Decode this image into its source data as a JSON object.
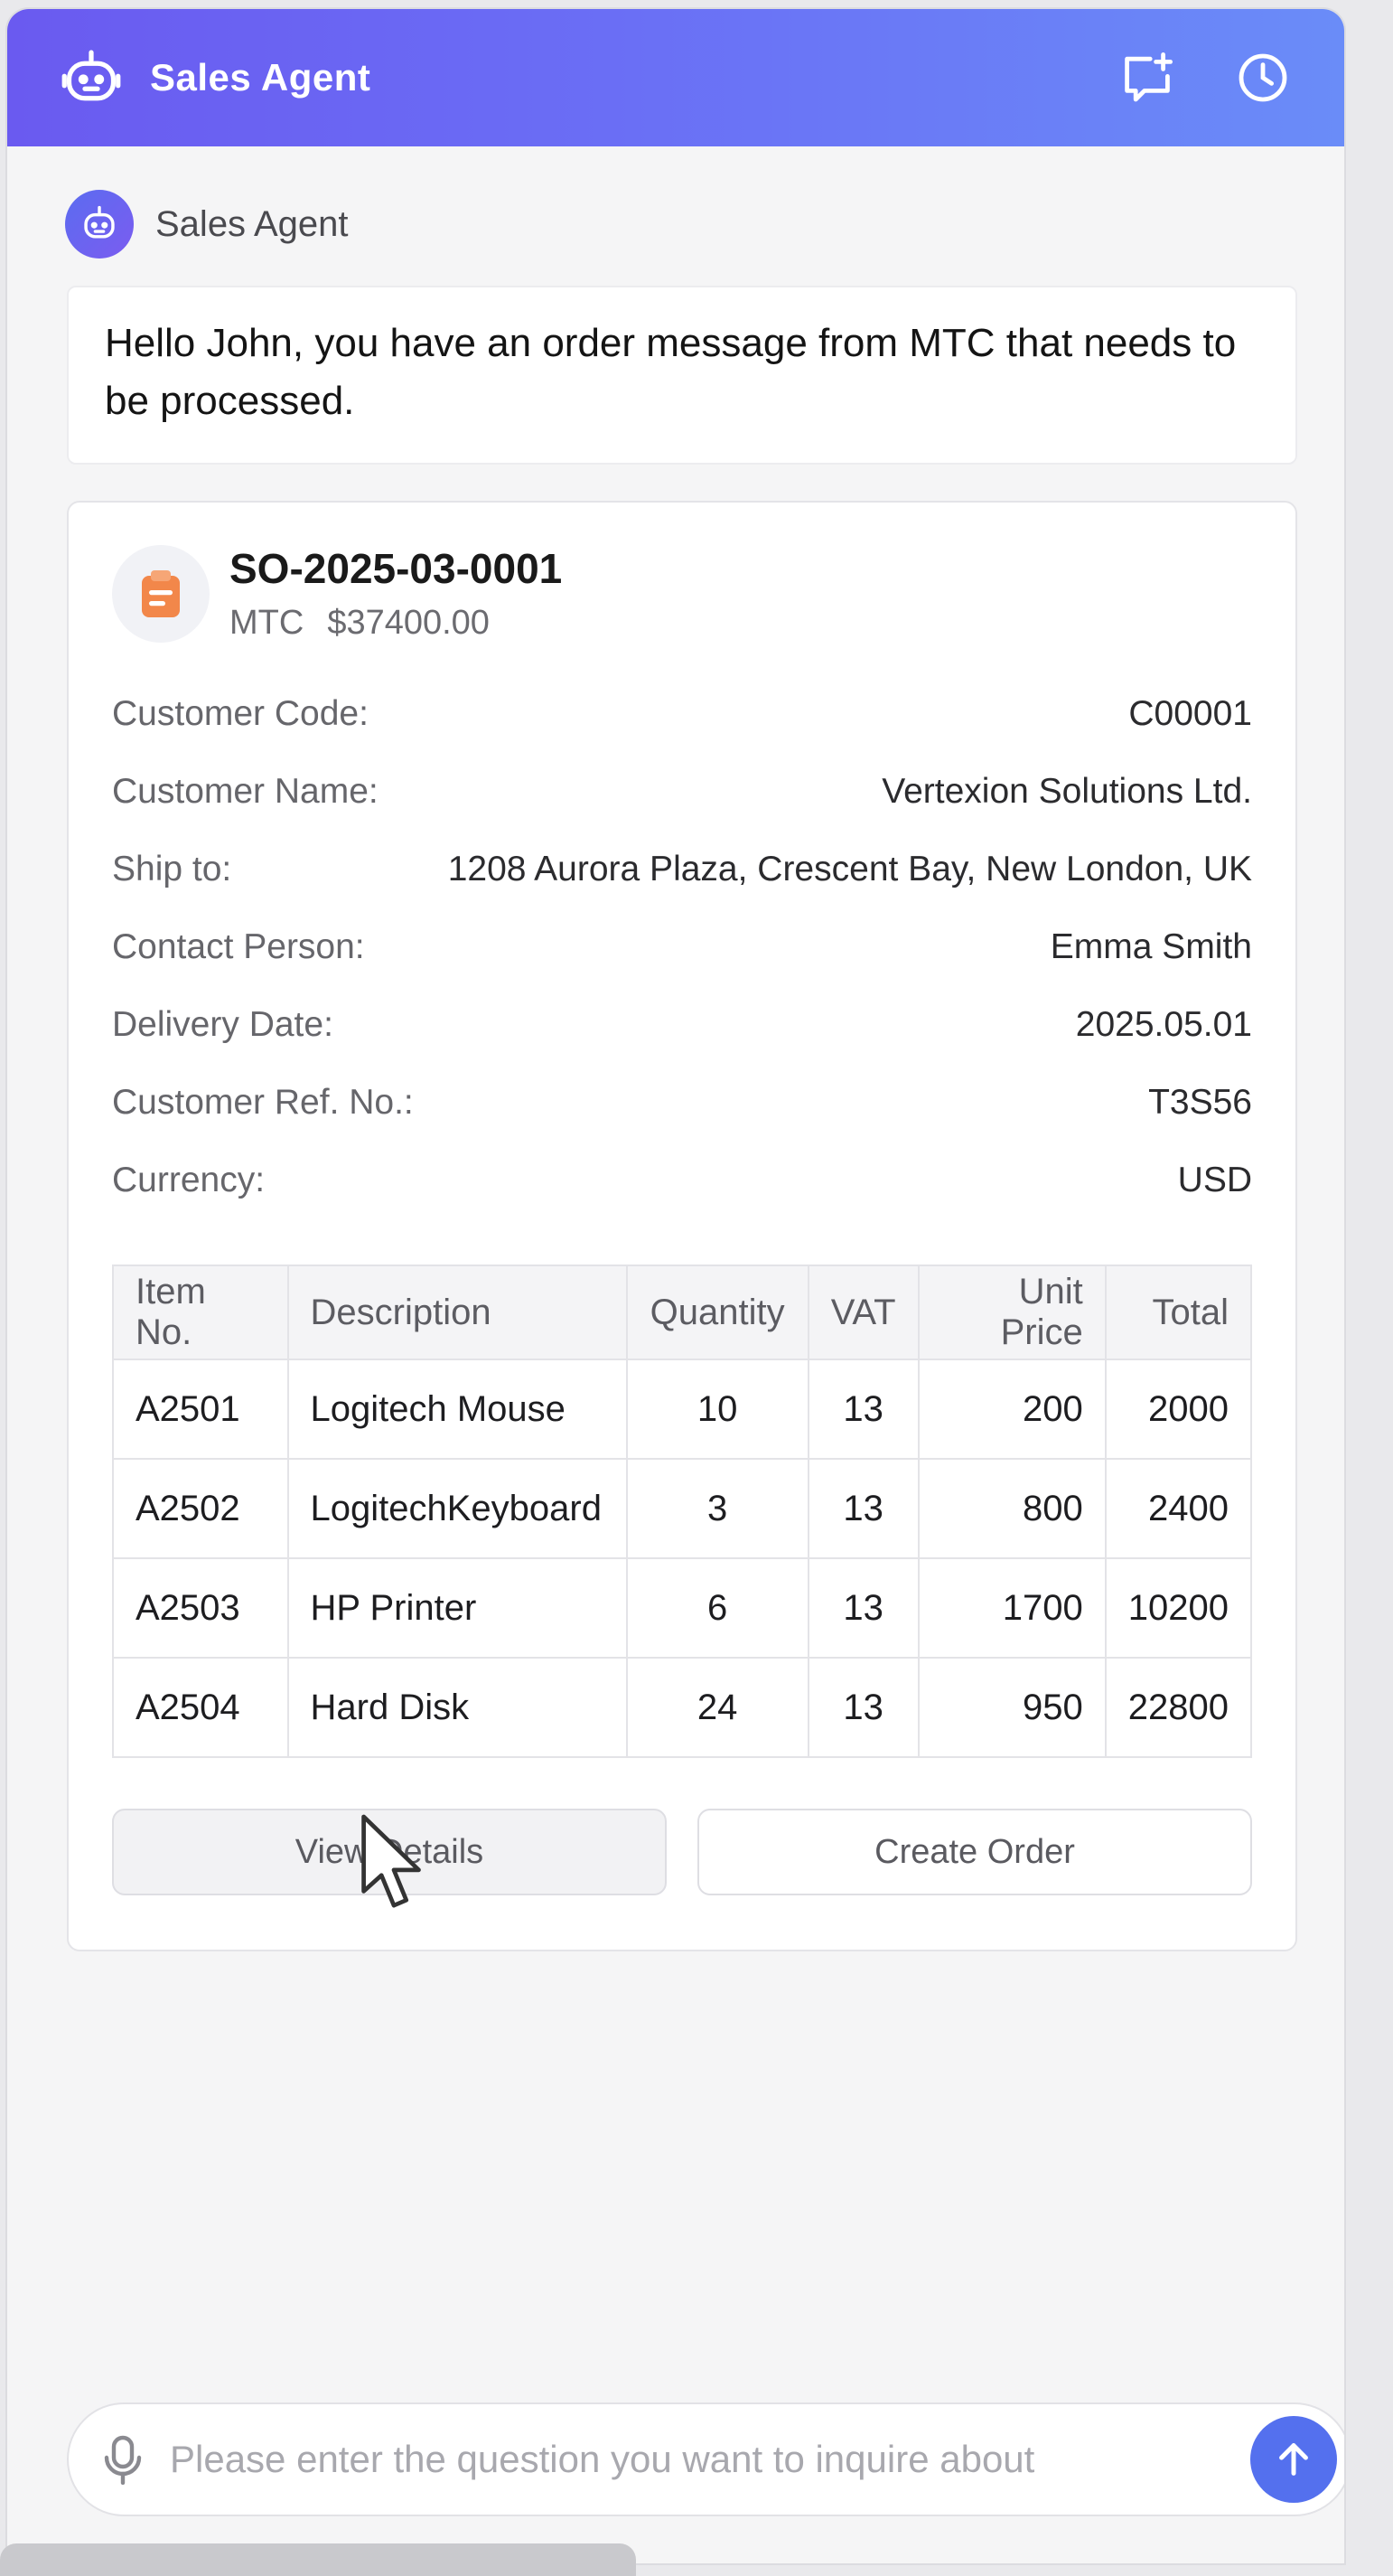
{
  "header": {
    "title": "Sales Agent",
    "gradient": [
      "#6a5af0",
      "#6a8cf8"
    ],
    "icons": [
      "robot-icon",
      "new-chat-icon",
      "history-icon"
    ]
  },
  "agent": {
    "name": "Sales Agent"
  },
  "message": {
    "text": "Hello John, you have an order message from MTC that needs to be processed."
  },
  "order": {
    "number": "SO-2025-03-0001",
    "company": "MTC",
    "amount": "$37400.00",
    "fields": [
      {
        "label": "Customer Code:",
        "value": "C00001"
      },
      {
        "label": "Customer Name:",
        "value": "Vertexion Solutions Ltd."
      },
      {
        "label": "Ship to:",
        "value": "1208 Aurora Plaza, Crescent Bay, New London, UK"
      },
      {
        "label": "Contact Person:",
        "value": "Emma Smith"
      },
      {
        "label": "Delivery Date:",
        "value": "2025.05.01"
      },
      {
        "label": "Customer Ref. No.:",
        "value": "T3S56"
      },
      {
        "label": "Currency:",
        "value": "USD"
      }
    ],
    "table": {
      "headers": [
        "Item No.",
        "Description",
        "Quantity",
        "VAT",
        "Unit Price",
        "Total"
      ],
      "rows": [
        [
          "A2501",
          "Logitech Mouse",
          "10",
          "13",
          "200",
          "2000"
        ],
        [
          "A2502",
          "LogitechKeyboard",
          "3",
          "13",
          "800",
          "2400"
        ],
        [
          "A2503",
          "HP Printer",
          "6",
          "13",
          "1700",
          "10200"
        ],
        [
          "A2504",
          "Hard Disk",
          "24",
          "13",
          "950",
          "22800"
        ]
      ]
    },
    "actions": {
      "view": "View Details",
      "create": "Create Order"
    }
  },
  "input": {
    "placeholder": "Please enter the question you want to inquire about",
    "value": ""
  },
  "colors": {
    "accent": "#5470ee",
    "doc_icon": "#f2874a"
  }
}
